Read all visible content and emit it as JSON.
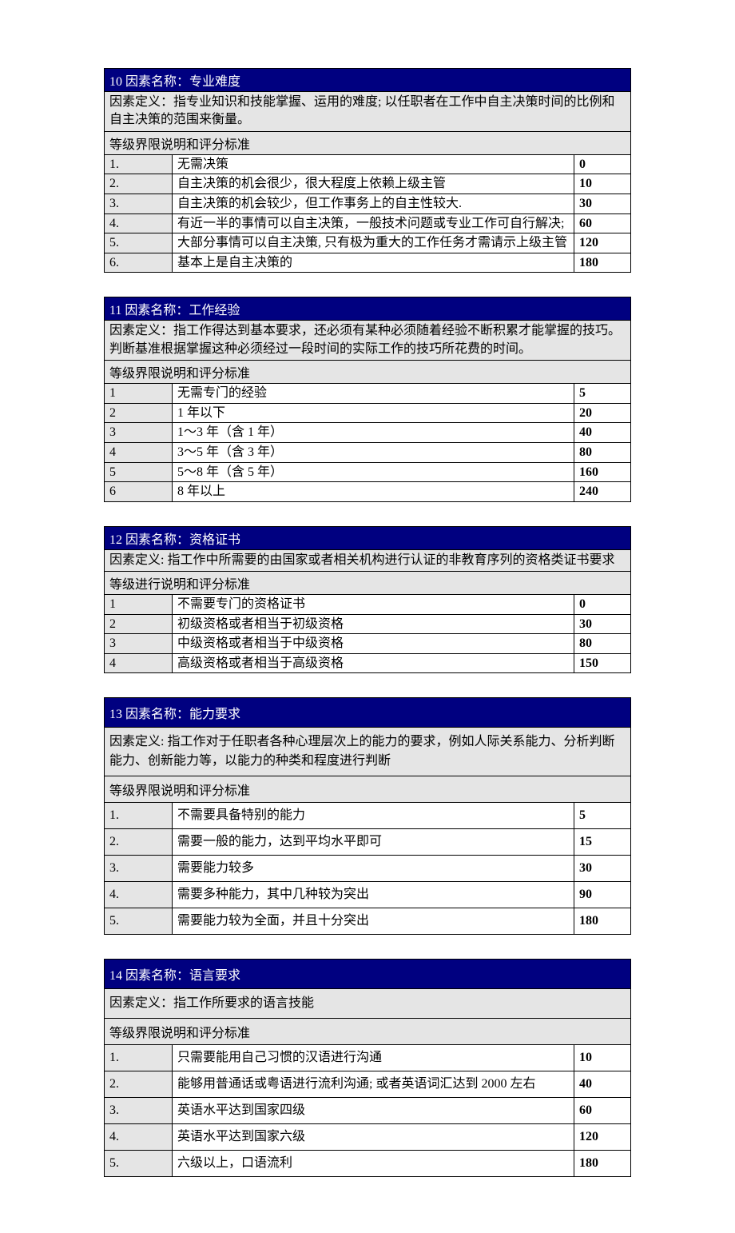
{
  "factors": [
    {
      "title": "10 因素名称：专业难度",
      "definition": "因素定义：指专业知识和技能掌握、运用的难度; 以任职者在工作中自主决策时间的比例和自主决策的范围来衡量。",
      "levelHeader": "等级界限说明和评分标准",
      "tall": false,
      "levels": [
        {
          "idx": "1.",
          "desc": "无需决策",
          "score": "0"
        },
        {
          "idx": "2.",
          "desc": "自主决策的机会很少，很大程度上依赖上级主管",
          "score": "10"
        },
        {
          "idx": "3.",
          "desc": "自主决策的机会较少，但工作事务上的自主性较大.",
          "score": "30"
        },
        {
          "idx": "4.",
          "desc": "有近一半的事情可以自主决策，一般技术问题或专业工作可自行解决;",
          "score": "60"
        },
        {
          "idx": "5.",
          "desc": "大部分事情可以自主决策, 只有极为重大的工作任务才需请示上级主管",
          "score": "120"
        },
        {
          "idx": "6.",
          "desc": "基本上是自主决策的",
          "score": "180"
        }
      ]
    },
    {
      "title": "11 因素名称：工作经验",
      "definition": "因素定义：指工作得达到基本要求，还必须有某种必须随着经验不断积累才能掌握的技巧。判断基准根据掌握这种必须经过一段时间的实际工作的技巧所花费的时间。",
      "levelHeader": "等级界限说明和评分标准",
      "tall": false,
      "levels": [
        {
          "idx": "1",
          "desc": "无需专门的经验",
          "score": "5"
        },
        {
          "idx": "2",
          "desc": "1 年以下",
          "score": "20"
        },
        {
          "idx": "3",
          "desc": "1～3 年（含 1 年）",
          "score": "40"
        },
        {
          "idx": "4",
          "desc": "3～5 年（含 3 年）",
          "score": "80"
        },
        {
          "idx": "5",
          "desc": "5～8 年（含 5 年）",
          "score": "160"
        },
        {
          "idx": "6",
          "desc": "8 年以上",
          "score": "240"
        }
      ]
    },
    {
      "title": "12 因素名称：资格证书",
      "definition": "因素定义: 指工作中所需要的由国家或者相关机构进行认证的非教育序列的资格类证书要求",
      "levelHeader": "等级进行说明和评分标准",
      "tall": false,
      "levels": [
        {
          "idx": "1",
          "desc": "不需要专门的资格证书",
          "score": "0"
        },
        {
          "idx": "2",
          "desc": "初级资格或者相当于初级资格",
          "score": "30"
        },
        {
          "idx": "3",
          "desc": "中级资格或者相当于中级资格",
          "score": "80"
        },
        {
          "idx": "4",
          "desc": "高级资格或者相当于高级资格",
          "score": "150"
        }
      ]
    },
    {
      "title": "13 因素名称：能力要求",
      "definition": "因素定义: 指工作对于任职者各种心理层次上的能力的要求，例如人际关系能力、分析判断能力、创新能力等，以能力的种类和程度进行判断",
      "levelHeader": "等级界限说明和评分标准",
      "tall": true,
      "levels": [
        {
          "idx": "1.",
          "desc": "不需要具备特别的能力",
          "score": "5"
        },
        {
          "idx": "2.",
          "desc": "需要一般的能力，达到平均水平即可",
          "score": "15"
        },
        {
          "idx": "3.",
          "desc": "需要能力较多",
          "score": "30"
        },
        {
          "idx": "4.",
          "desc": "需要多种能力，其中几种较为突出",
          "score": "90"
        },
        {
          "idx": "5.",
          "desc": "需要能力较为全面，并且十分突出",
          "score": "180"
        }
      ]
    },
    {
      "title": "14 因素名称：语言要求",
      "definition": "因素定义：指工作所要求的语言技能",
      "levelHeader": "等级界限说明和评分标准",
      "tall": true,
      "levels": [
        {
          "idx": "1.",
          "desc": "只需要能用自己习惯的汉语进行沟通",
          "score": "10"
        },
        {
          "idx": "2.",
          "desc": "能够用普通话或粤语进行流利沟通; 或者英语词汇达到 2000 左右",
          "score": "40"
        },
        {
          "idx": "3.",
          "desc": "英语水平达到国家四级",
          "score": "60"
        },
        {
          "idx": "4.",
          "desc": "英语水平达到国家六级",
          "score": "120"
        },
        {
          "idx": "5.",
          "desc": "六级以上，口语流利",
          "score": "180"
        }
      ]
    }
  ]
}
